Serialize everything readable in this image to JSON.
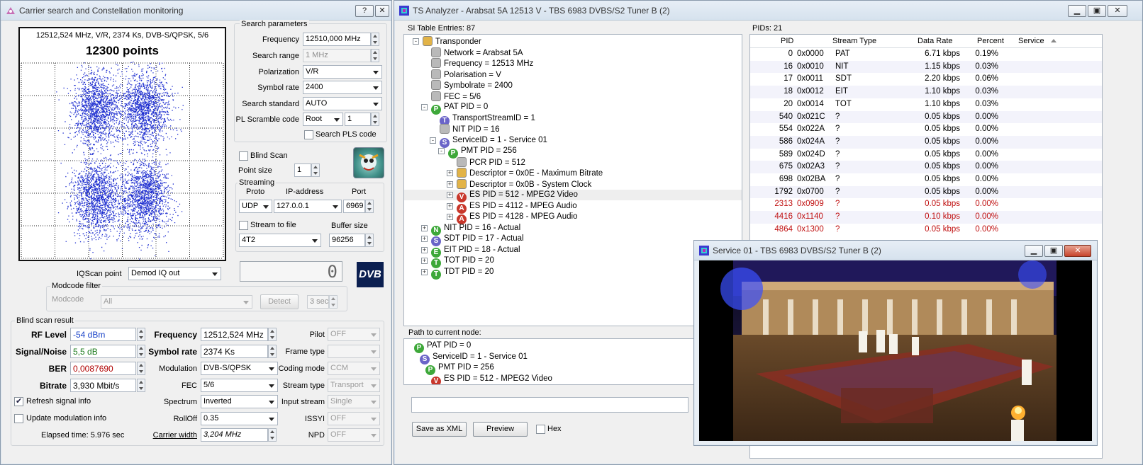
{
  "left_window": {
    "title": "Carrier search and Constellation monitoring",
    "help_btn": "?",
    "close_btn": "✕",
    "constellation": {
      "info": "12512,524 MHz, V/R, 2374 Ks, DVB-S/QPSK, 5/6",
      "points_label": "12300 points",
      "point_color": "#1f2fd0"
    },
    "search": {
      "group_label": "Search parameters",
      "frequency_label": "Frequency",
      "frequency_value": "12510,000 MHz",
      "range_label": "Search range",
      "range_value": "1 MHz",
      "polarization_label": "Polarization",
      "polarization_value": "V/R",
      "symbolrate_label": "Symbol rate",
      "symbolrate_value": "2400",
      "standard_label": "Search standard",
      "standard_value": "AUTO",
      "pls_label": "PL Scramble code",
      "pls_mode": "Root",
      "pls_value": "1",
      "search_pls_label": "Search PLS code"
    },
    "blind_scan_label": "Blind Scan",
    "point_size_label": "Point size",
    "point_size_value": "1",
    "streaming": {
      "group_label": "Streaming",
      "proto_label": "Proto",
      "ip_label": "IP-address",
      "port_label": "Port",
      "proto_value": "UDP",
      "ip_value": "127.0.0.1",
      "port_value": "6969",
      "stream_to_file_label": "Stream to file",
      "buffer_label": "Buffer size",
      "file_value": "4T2",
      "buffer_value": "96256"
    },
    "iq_label": "IQScan point",
    "iq_value": "Demod IQ out",
    "lcd_value": "0",
    "dvb_logo": "DVB",
    "modcode": {
      "group_label": "Modcode filter",
      "label": "Modcode",
      "value": "All",
      "detect": "Detect",
      "interval": "3 sec"
    },
    "result": {
      "group_label": "Blind scan result",
      "rf_label": "RF Level",
      "rf_value": "-54 dBm",
      "sn_label": "Signal/Noise",
      "sn_value": "5,5 dB",
      "ber_label": "BER",
      "ber_value": "0,0087690",
      "bitrate_label": "Bitrate",
      "bitrate_value": "3,930 Mbit/s",
      "freq_label": "Frequency",
      "freq_value": "12512,524 MHz",
      "sr_label": "Symbol rate",
      "sr_value": "2374 Ks",
      "mod_label": "Modulation",
      "mod_value": "DVB-S/QPSK",
      "fec_label": "FEC",
      "fec_value": "5/6",
      "spectrum_label": "Spectrum",
      "spectrum_value": "Inverted",
      "rolloff_label": "RollOff",
      "rolloff_value": "0.35",
      "cw_label": "Carrier width",
      "cw_value": "3,204 MHz",
      "pilot_label": "Pilot",
      "pilot_value": "OFF",
      "frame_label": "Frame type",
      "frame_value": "",
      "coding_label": "Coding mode",
      "coding_value": "CCM",
      "stype_label": "Stream type",
      "stype_value": "Transport",
      "istream_label": "Input stream",
      "istream_value": "Single",
      "issyi_label": "ISSYI",
      "issyi_value": "OFF",
      "npd_label": "NPD",
      "npd_value": "OFF"
    },
    "refresh_label": "Refresh signal info",
    "update_mod_label": "Update modulation info",
    "elapsed": "Elapsed time: 5.976 sec"
  },
  "right_window": {
    "title": "TS Analyzer - Arabsat 5A 12513 V - TBS 6983 DVBS/S2 Tuner B (2)",
    "si_header": "SI Table Entries: 87",
    "pids_header": "PIDs: 21",
    "tree": [
      {
        "t": "Transponder",
        "icon": "folder"
      },
      {
        "t": "Network = Arabsat 5A",
        "icon": "gray"
      },
      {
        "t": "Frequency = 12513 MHz",
        "icon": "gray"
      },
      {
        "t": "Polarisation = V",
        "icon": "gray"
      },
      {
        "t": "Symbolrate = 2400",
        "icon": "gray"
      },
      {
        "t": "FEC = 5/6",
        "icon": "gray"
      },
      {
        "t": "PAT PID = 0",
        "icon": "P"
      },
      {
        "t": "TransportStreamID = 1",
        "icon": "T"
      },
      {
        "t": "NIT PID = 16",
        "icon": "gray"
      },
      {
        "t": "ServiceID = 1 - Service 01",
        "icon": "S"
      },
      {
        "t": "PMT PID = 256",
        "icon": "P"
      },
      {
        "t": "PCR PID = 512",
        "icon": "gray"
      },
      {
        "t": "Descriptor = 0x0E - Maximum Bitrate",
        "icon": "folder"
      },
      {
        "t": "Descriptor = 0x0B - System Clock",
        "icon": "folder"
      },
      {
        "t": "ES PID = 512 - MPEG2 Video",
        "icon": "V"
      },
      {
        "t": "ES PID = 4112 - MPEG Audio",
        "icon": "A"
      },
      {
        "t": "ES PID = 4128 - MPEG Audio",
        "icon": "A"
      },
      {
        "t": "NIT PID = 16 - Actual",
        "icon": "N"
      },
      {
        "t": "SDT PID = 17 - Actual",
        "icon": "S"
      },
      {
        "t": "EIT PID = 18 - Actual",
        "icon": "E"
      },
      {
        "t": "TOT PID = 20",
        "icon": "TOT"
      },
      {
        "t": "TDT PID = 20",
        "icon": "TDT"
      }
    ],
    "table_headers": [
      "PID",
      "Stream Type",
      "Data Rate",
      "Percent",
      "Service"
    ],
    "table_rows": [
      [
        "0",
        "0x0000",
        "PAT",
        "6.71 kbps",
        "0.19%"
      ],
      [
        "16",
        "0x0010",
        "NIT",
        "1.15 kbps",
        "0.03%"
      ],
      [
        "17",
        "0x0011",
        "SDT",
        "2.20 kbps",
        "0.06%"
      ],
      [
        "18",
        "0x0012",
        "EIT",
        "1.10 kbps",
        "0.03%"
      ],
      [
        "20",
        "0x0014",
        "TOT",
        "1.10 kbps",
        "0.03%"
      ],
      [
        "540",
        "0x021C",
        "?",
        "0.05 kbps",
        "0.00%"
      ],
      [
        "554",
        "0x022A",
        "?",
        "0.05 kbps",
        "0.00%"
      ],
      [
        "586",
        "0x024A",
        "?",
        "0.05 kbps",
        "0.00%"
      ],
      [
        "589",
        "0x024D",
        "?",
        "0.05 kbps",
        "0.00%"
      ],
      [
        "675",
        "0x02A3",
        "?",
        "0.05 kbps",
        "0.00%"
      ],
      [
        "698",
        "0x02BA",
        "?",
        "0.05 kbps",
        "0.00%"
      ],
      [
        "1792",
        "0x0700",
        "?",
        "0.05 kbps",
        "0.00%"
      ],
      [
        "2313",
        "0x0909",
        "?",
        "0.05 kbps",
        "0.00%"
      ],
      [
        "4416",
        "0x1140",
        "?",
        "0.10 kbps",
        "0.00%"
      ],
      [
        "4864",
        "0x1300",
        "?",
        "0.05 kbps",
        "0.00%"
      ]
    ],
    "path_label": "Path to current node:",
    "path": [
      {
        "t": "PAT PID = 0",
        "icon": "P"
      },
      {
        "t": "ServiceID = 1 - Service 01",
        "icon": "S"
      },
      {
        "t": "PMT PID = 256",
        "icon": "P"
      },
      {
        "t": "ES PID = 512 - MPEG2 Video",
        "icon": "V"
      }
    ],
    "save_xml": "Save as XML",
    "preview": "Preview",
    "hex_label": "Hex"
  },
  "video_window": {
    "title": "Service 01 - TBS 6983 DVBS/S2 Tuner B (2)"
  }
}
